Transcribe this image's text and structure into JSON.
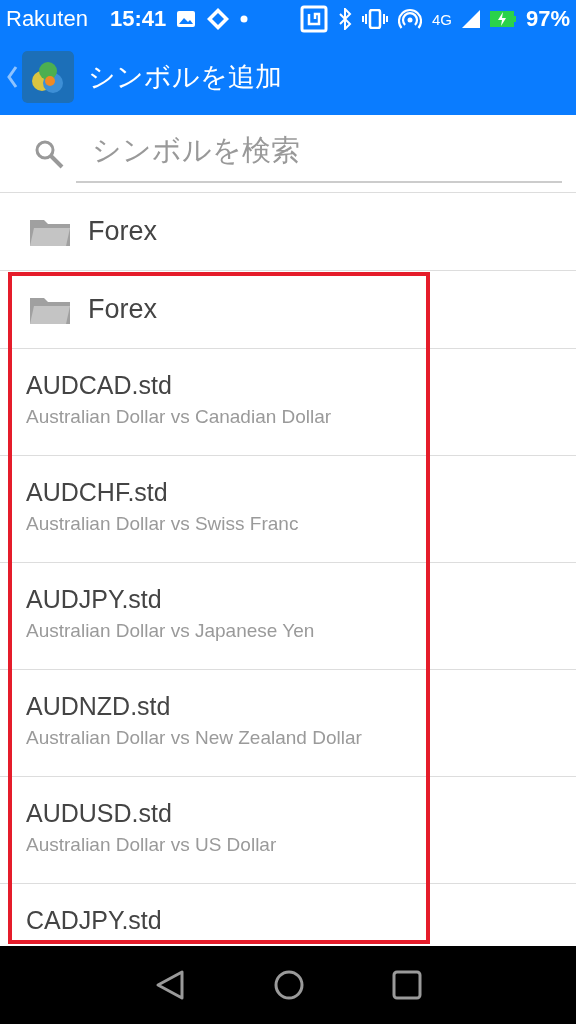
{
  "status_bar": {
    "carrier": "Rakuten",
    "time": "15:41",
    "network": "4G",
    "battery": "97%"
  },
  "app_bar": {
    "title": "シンボルを追加"
  },
  "search": {
    "placeholder": "シンボルを検索"
  },
  "folders": [
    {
      "name": "Forex"
    },
    {
      "name": "Forex"
    }
  ],
  "symbols": [
    {
      "name": "AUDCAD.std",
      "description": "Australian Dollar vs Canadian Dollar"
    },
    {
      "name": "AUDCHF.std",
      "description": "Australian Dollar vs Swiss Franc"
    },
    {
      "name": "AUDJPY.std",
      "description": "Australian Dollar vs Japanese Yen"
    },
    {
      "name": "AUDNZD.std",
      "description": "Australian Dollar vs New Zealand Dollar"
    },
    {
      "name": "AUDUSD.std",
      "description": "Australian Dollar vs US Dollar"
    },
    {
      "name": "CADJPY.std"
    }
  ]
}
